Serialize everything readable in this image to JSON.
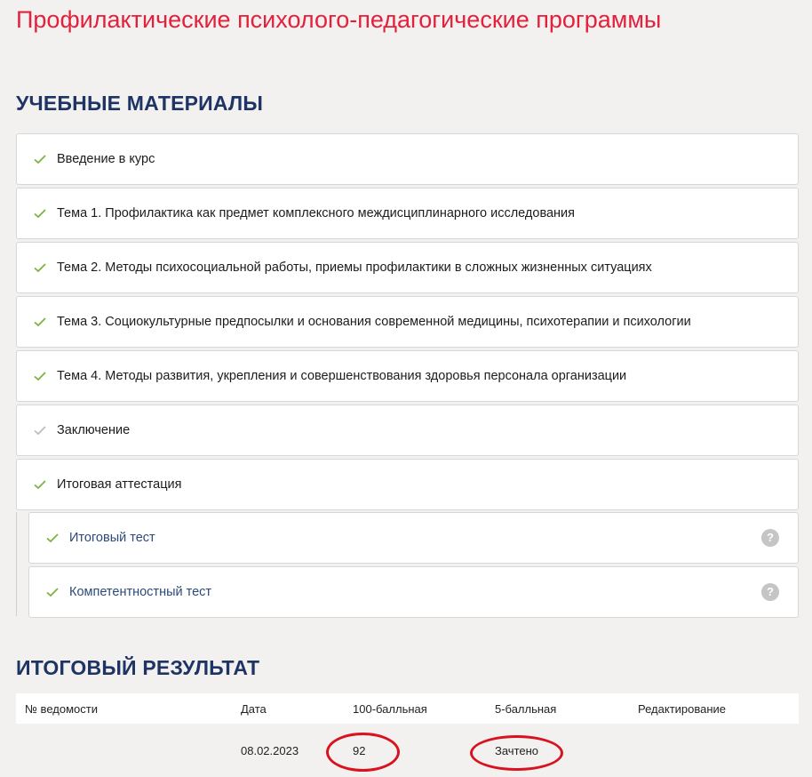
{
  "page": {
    "title": "Профилактические психолого-педагогические программы"
  },
  "materials": {
    "heading": "УЧЕБНЫЕ МАТЕРИАЛЫ",
    "items": [
      {
        "label": "Введение в курс",
        "status": "done"
      },
      {
        "label": "Тема 1. Профилактика как предмет комплексного междисциплинарного исследования",
        "status": "done"
      },
      {
        "label": "Тема 2. Методы психосоциальной работы, приемы профилактики в сложных жизненных ситуациях",
        "status": "done"
      },
      {
        "label": "Тема 3. Социокультурные предпосылки и основания современной медицины, психотерапии и психологии",
        "status": "done"
      },
      {
        "label": "Тема 4. Методы развития, укрепления и совершенствования здоровья персонала организации",
        "status": "done"
      },
      {
        "label": "Заключение",
        "status": "pending"
      },
      {
        "label": "Итоговая аттестация",
        "status": "done"
      }
    ],
    "sub_items": [
      {
        "label": "Итоговый тест",
        "status": "done",
        "help": "?"
      },
      {
        "label": "Компетентностный тест",
        "status": "done",
        "help": "?"
      }
    ]
  },
  "result": {
    "heading": "ИТОГОВЫЙ РЕЗУЛЬТАТ",
    "columns": [
      "№ ведомости",
      "Дата",
      "100-балльная",
      "5-балльная",
      "Редактирование"
    ],
    "rows": [
      [
        "",
        "08.02.2023",
        "92",
        "Зачтено",
        ""
      ]
    ]
  },
  "colors": {
    "title": "#e4203c",
    "heading": "#1e3464",
    "check_done": "#7cb342",
    "check_pending": "#bdbdbd",
    "highlight": "#d8121f"
  },
  "icons": {
    "check": "check-icon",
    "help": "help-icon"
  }
}
